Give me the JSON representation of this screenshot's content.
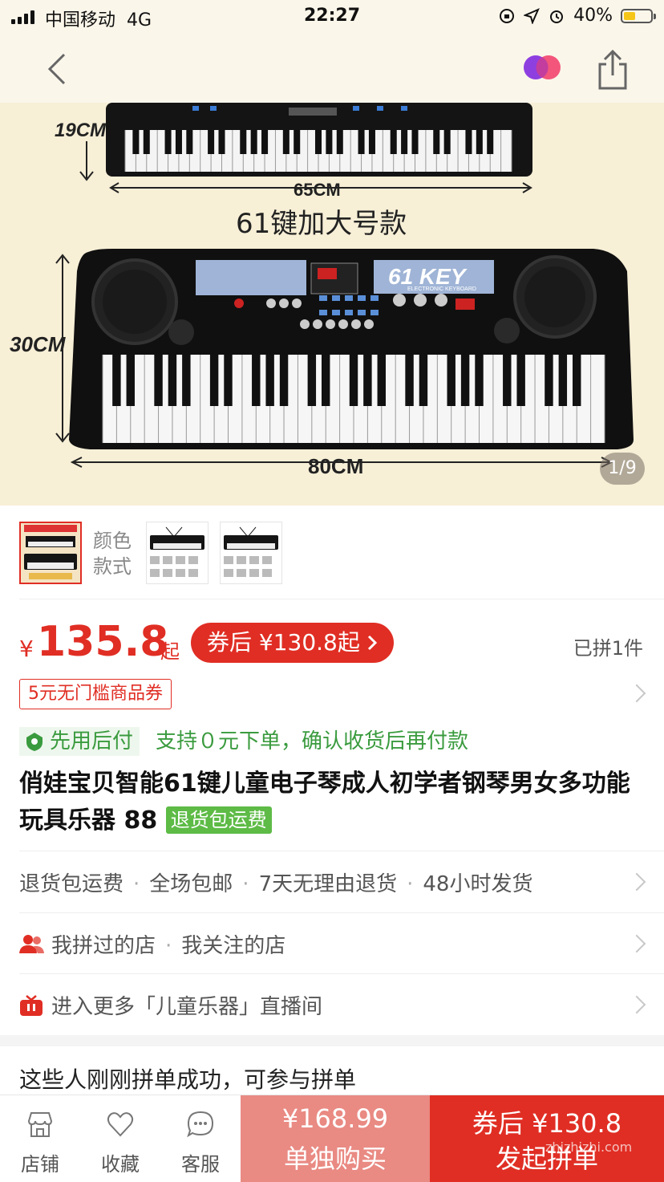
{
  "status_bar": {
    "carrier": "中国移动",
    "network": "4G",
    "time": "22:27",
    "battery": "40%"
  },
  "hero": {
    "label_19cm": "19CM",
    "label_65cm": "65CM",
    "variant_caption": "61键加大号款",
    "label_30cm": "30CM",
    "label_80cm": "80CM",
    "key_badge": "61 KEY",
    "key_badge_sub": "ELECTRONIC KEYBOARD",
    "page_indicator": "1/9"
  },
  "variants": {
    "label_line1": "颜色",
    "label_line2": "款式"
  },
  "price": {
    "currency": "¥",
    "amount": "135.8",
    "suffix": "起",
    "coupon_price": "券后 ¥130.8起",
    "sold_count": "已拼1件",
    "voucher": "5元无门槛商品券"
  },
  "pay_later": {
    "badge": "先用后付",
    "desc": "支持０元下单，确认收货后再付款"
  },
  "product": {
    "title": "俏娃宝贝智能61键儿童电子琴成人初学者钢琴男女多功能玩具乐器 88",
    "return_badge": "退货包运费"
  },
  "services": [
    "退货包运费",
    "全场包邮",
    "7天无理由退货",
    "48小时发货"
  ],
  "shops": {
    "visited": "我拼过的店",
    "followed": "我关注的店"
  },
  "live": "进入更多「儿童乐器」直播间",
  "group_title": "这些人刚刚拼单成功，可参与拼单",
  "bottom_bar": {
    "tabs": [
      "店铺",
      "收藏",
      "客服"
    ],
    "alone_price": "¥168.99",
    "alone_label": "单独购买",
    "group_price": "券后 ¥130.8",
    "group_label": "发起拼单"
  },
  "watermark": "zhizhizhi.com",
  "colors": {
    "brand_red": "#e02e24",
    "green": "#3a9b3e",
    "hero_bg": "#f7efd6"
  }
}
